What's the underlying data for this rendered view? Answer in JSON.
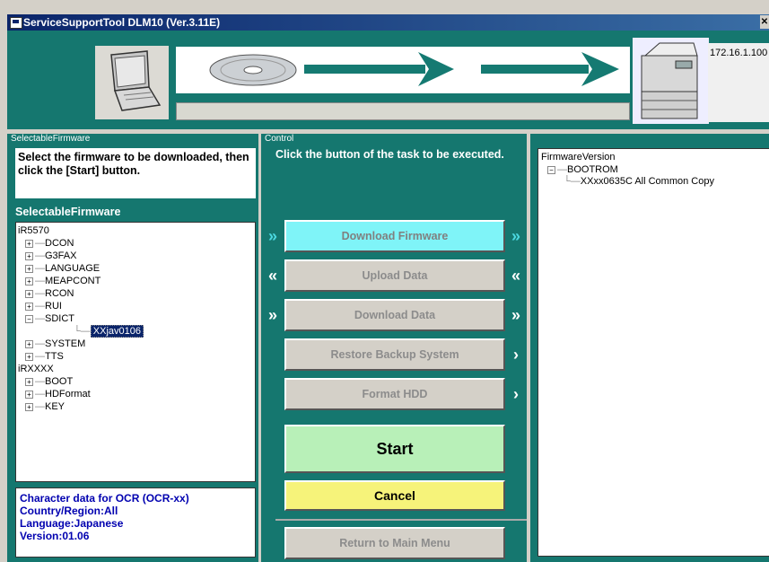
{
  "window": {
    "title": "ServiceSupportTool DLM10 (Ver.3.11E)"
  },
  "banner": {
    "ip_address": "172.16.1.100"
  },
  "left": {
    "group_label": "SelectableFirmware",
    "instruction": "Select the firmware to be downloaded, then click the [Start] button.",
    "header": "SelectableFirmware",
    "tree": [
      {
        "label": "iR5570",
        "level": 0,
        "expander": ""
      },
      {
        "label": "DCON",
        "level": 1,
        "expander": "+"
      },
      {
        "label": "G3FAX",
        "level": 1,
        "expander": "+"
      },
      {
        "label": "LANGUAGE",
        "level": 1,
        "expander": "+"
      },
      {
        "label": "MEAPCONT",
        "level": 1,
        "expander": "+"
      },
      {
        "label": "RCON",
        "level": 1,
        "expander": "+"
      },
      {
        "label": "RUI",
        "level": 1,
        "expander": "+"
      },
      {
        "label": "SDICT",
        "level": 1,
        "expander": "-"
      },
      {
        "label": "XXjav0106",
        "level": 2,
        "expander": "",
        "selected": true
      },
      {
        "label": "SYSTEM",
        "level": 1,
        "expander": "+"
      },
      {
        "label": "TTS",
        "level": 1,
        "expander": "+"
      },
      {
        "label": "iRXXXX",
        "level": 0,
        "expander": ""
      },
      {
        "label": "BOOT",
        "level": 1,
        "expander": "+"
      },
      {
        "label": "HDFormat",
        "level": 1,
        "expander": "+"
      },
      {
        "label": "KEY",
        "level": 1,
        "expander": "+"
      }
    ],
    "info": {
      "line1": "Character data for OCR (OCR-xx)",
      "line2": "Country/Region:All",
      "line3": "Language:Japanese",
      "line4": "Version:01.06"
    }
  },
  "center": {
    "group_label": "Control",
    "instruction": "Click the button of the task to be executed.",
    "buttons": {
      "download_firmware": "Download Firmware",
      "upload_data": "Upload Data",
      "download_data": "Download Data",
      "restore_backup": "Restore Backup System",
      "format_hdd": "Format HDD",
      "start": "Start",
      "cancel": "Cancel",
      "return_main": "Return to Main Menu"
    }
  },
  "right": {
    "header": "FirmwareVersion",
    "node": "BOOTROM",
    "child": "XXxx0635C All Common Copy"
  },
  "colors": {
    "background": "#15776f",
    "highlight": "#7ff4f8",
    "start": "#b8f0b8",
    "cancel": "#f6f37a",
    "info_text": "#0000b0"
  },
  "icons": [
    "laptop-icon",
    "cd-disc-icon",
    "right-arrow-icon",
    "printer-icon",
    "double-chevron-right-icon",
    "double-chevron-left-icon",
    "chevron-right-icon"
  ]
}
